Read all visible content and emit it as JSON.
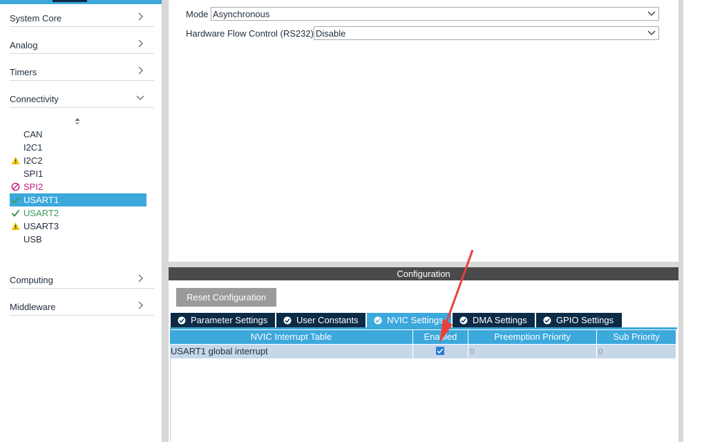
{
  "sidebar": {
    "categories": [
      {
        "label": "System Core",
        "expanded": false
      },
      {
        "label": "Analog",
        "expanded": false
      },
      {
        "label": "Timers",
        "expanded": false
      },
      {
        "label": "Connectivity",
        "expanded": true
      },
      {
        "label": "Computing",
        "expanded": false
      },
      {
        "label": "Middleware",
        "expanded": false
      }
    ],
    "peripherals": [
      {
        "label": "CAN",
        "status": "none"
      },
      {
        "label": "I2C1",
        "status": "none"
      },
      {
        "label": "I2C2",
        "status": "warning",
        "icon": "warning-icon"
      },
      {
        "label": "SPI1",
        "status": "none"
      },
      {
        "label": "SPI2",
        "status": "error",
        "icon": "disabled-icon"
      },
      {
        "label": "USART1",
        "status": "selected",
        "icon": "check-icon"
      },
      {
        "label": "USART2",
        "status": "ok",
        "icon": "check-icon"
      },
      {
        "label": "USART3",
        "status": "warning",
        "icon": "warning-icon"
      },
      {
        "label": "USB",
        "status": "none"
      }
    ]
  },
  "mode": {
    "mode_label": "Mode",
    "mode_value": "Asynchronous",
    "flow_label": "Hardware Flow Control (RS232)",
    "flow_value": "Disable"
  },
  "configuration": {
    "title": "Configuration",
    "reset_label": "Reset Configuration",
    "tabs": [
      {
        "label": "Parameter Settings",
        "active": false
      },
      {
        "label": "User Constants",
        "active": false
      },
      {
        "label": "NVIC Settings",
        "active": true
      },
      {
        "label": "DMA Settings",
        "active": false
      },
      {
        "label": "GPIO Settings",
        "active": false
      }
    ],
    "table": {
      "headers": [
        "NVIC Interrupt Table",
        "Enabled",
        "Preemption Priority",
        "Sub Priority"
      ],
      "rows": [
        {
          "name": "USART1 global interrupt",
          "enabled": true,
          "preemption": "0",
          "sub": "0"
        }
      ]
    }
  },
  "colors": {
    "accent": "#3ca8dc",
    "dark_tab": "#0b2b46",
    "header_bar": "#4a4a4a",
    "warning": "#f2c300",
    "error": "#c61b80",
    "ok": "#3b9a56",
    "annotation_arrow": "#e8413b"
  }
}
